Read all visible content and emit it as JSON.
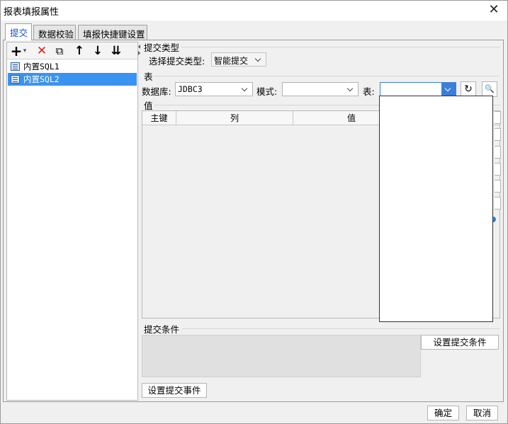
{
  "window": {
    "title": "报表填报属性",
    "close_glyph": "✕"
  },
  "tabs": [
    {
      "label": "提交"
    },
    {
      "label": "数据校验"
    },
    {
      "label": "填报快捷键设置"
    }
  ],
  "toolbar": {
    "add_glyph": "+",
    "add_menu_glyph": "▾",
    "delete_glyph": "✕",
    "copy_glyph": "⧉",
    "up_glyph": "↑",
    "down_glyph": "↓",
    "sort_glyph": "⇊"
  },
  "sql_items": [
    {
      "label": "内置SQL1"
    },
    {
      "label": "内置SQL2"
    }
  ],
  "submit_type": {
    "section_label": "提交类型",
    "field_label": "选择提交类型:",
    "value": "智能提交"
  },
  "table_section": {
    "section_label": "表",
    "db_label": "数据库:",
    "db_value": "JDBC3",
    "schema_label": "模式:",
    "schema_value": "",
    "table_label": "表:",
    "table_value": "",
    "refresh_glyph": "↻",
    "preview_glyph": "🔍"
  },
  "value_section": {
    "section_label": "值",
    "columns": [
      "主键",
      "列",
      "值"
    ],
    "rows": []
  },
  "condition_section": {
    "section_label": "提交条件",
    "set_condition_button": "设置提交条件"
  },
  "submit_event_button": "设置提交事件",
  "footer": {
    "ok_button": "确定",
    "cancel_button": "取消"
  }
}
